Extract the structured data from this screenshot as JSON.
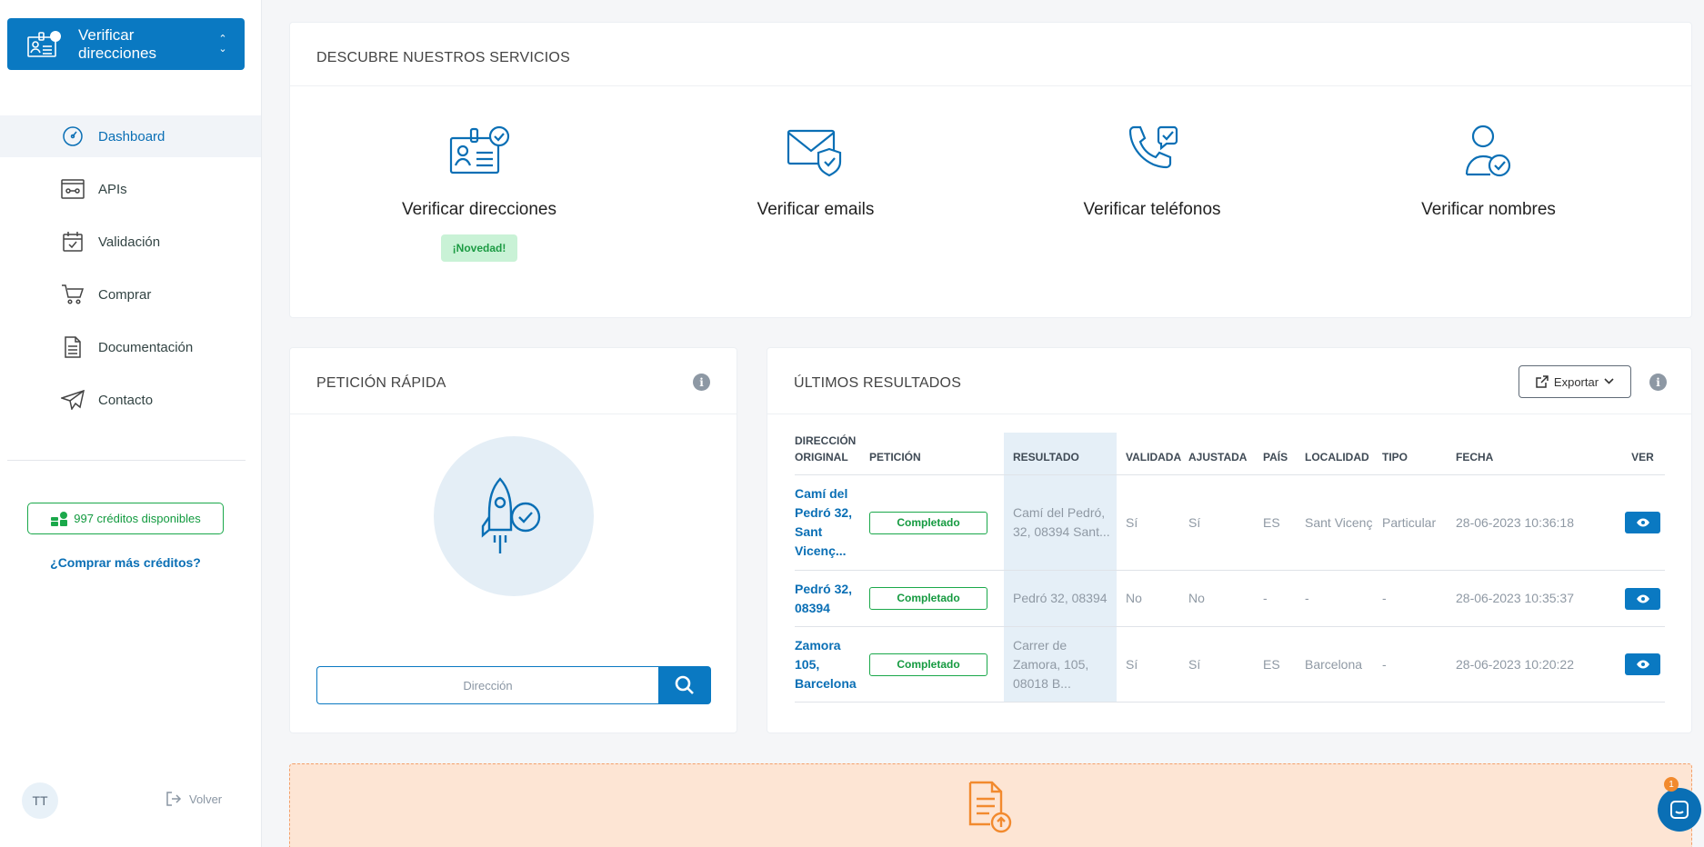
{
  "sidebar": {
    "app_title": "Verificar direcciones",
    "nav": [
      {
        "label": "Dashboard",
        "icon": "dashboard-gauge-icon",
        "active": true
      },
      {
        "label": "APIs",
        "icon": "api-window-icon"
      },
      {
        "label": "Validación",
        "icon": "calendar-check-icon"
      },
      {
        "label": "Comprar",
        "icon": "cart-icon"
      },
      {
        "label": "Documentación",
        "icon": "document-icon"
      },
      {
        "label": "Contacto",
        "icon": "paper-plane-icon"
      }
    ],
    "credits": "997 créditos disponibles",
    "buy_more": "¿Comprar más créditos?",
    "avatar": "TT",
    "back": "Volver"
  },
  "services": {
    "title": "DESCUBRE NUESTROS SERVICIOS",
    "items": [
      {
        "name": "Verificar direcciones",
        "badge": "¡Novedad!",
        "icon": "id-card-check-icon"
      },
      {
        "name": "Verificar emails",
        "icon": "envelope-shield-icon"
      },
      {
        "name": "Verificar teléfonos",
        "icon": "phone-chat-icon"
      },
      {
        "name": "Verificar nombres",
        "icon": "user-check-icon"
      }
    ]
  },
  "quick": {
    "title": "PETICIÓN RÁPIDA",
    "placeholder": "Dirección"
  },
  "results": {
    "title": "ÚLTIMOS RESULTADOS",
    "export": "Exportar",
    "columns": [
      "DIRECCIÓN ORIGINAL",
      "PETICIÓN",
      "RESULTADO",
      "VALIDADA",
      "AJUSTADA",
      "PAÍS",
      "LOCALIDAD",
      "TIPO",
      "FECHA",
      "VER"
    ],
    "rows": [
      {
        "direccion": "Camí del Pedró 32, Sant Vicenç...",
        "peticion": "Completado",
        "resultado": "Camí del Pedró, 32, 08394 Sant...",
        "validada": "Sí",
        "ajustada": "Sí",
        "pais": "ES",
        "localidad": "Sant Vicenç",
        "tipo": "Particular",
        "fecha": "28-06-2023 10:36:18"
      },
      {
        "direccion": "Pedró 32, 08394",
        "peticion": "Completado",
        "resultado": "Pedró 32, 08394",
        "validada": "No",
        "ajustada": "No",
        "pais": "-",
        "localidad": "-",
        "tipo": "-",
        "fecha": "28-06-2023 10:35:37"
      },
      {
        "direccion": "Zamora 105, Barcelona",
        "peticion": "Completado",
        "resultado": "Carrer de Zamora, 105, 08018 B...",
        "validada": "Sí",
        "ajustada": "Sí",
        "pais": "ES",
        "localidad": "Barcelona",
        "tipo": "-",
        "fecha": "28-06-2023 10:20:22"
      }
    ]
  },
  "upload": {
    "icon": "file-upload-icon"
  },
  "chat": {
    "badge": "1"
  },
  "colors": {
    "primary": "#0a79c2",
    "success": "#1aa84a",
    "upload_bg": "#fde5d4",
    "upload_accent": "#f28a2e"
  }
}
